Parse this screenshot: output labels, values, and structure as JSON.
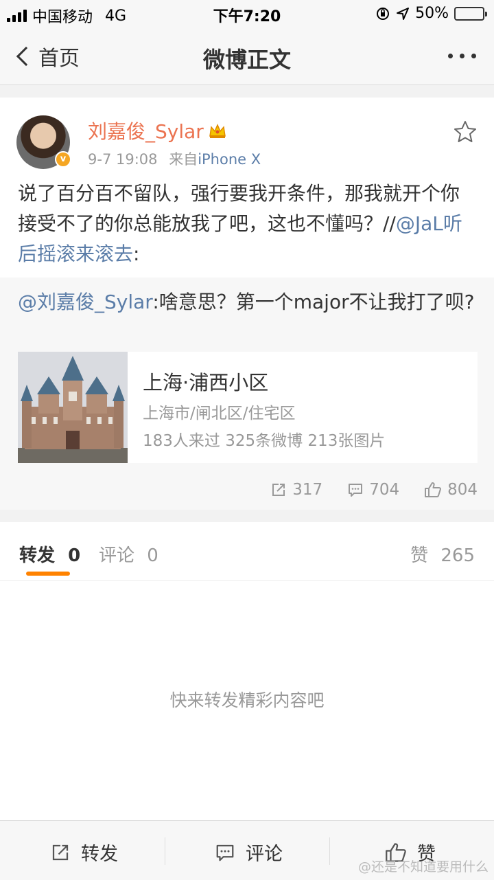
{
  "status_bar": {
    "carrier": "中国移动",
    "network": "4G",
    "time": "下午7:20",
    "battery": "50%",
    "battery_level": 0.5,
    "battery_color": "#f5c400"
  },
  "nav": {
    "back_label": "首页",
    "title": "微博正文"
  },
  "post": {
    "author": "刘嘉俊_Sylar",
    "verified_badge": "v",
    "time": "9-7 19:08",
    "source_prefix": "来自",
    "source": "iPhone X",
    "text": "说了百分百不留队，强行要我开条件，那我就开个你接受不了的你总能放我了吧，这也不懂吗？//",
    "mention": "@JaL听后摇滚来滚去",
    "mention_suffix": ":",
    "repost": {
      "mention": "@刘嘉俊_Sylar",
      "text": ":啥意思？第一个major不让我打了呗?",
      "location": {
        "name": "上海·浦西小区",
        "address": "上海市/闸北区/住宅区",
        "stats": "183人来过 325条微博 213张图片"
      }
    },
    "actions": {
      "forward_count": "317",
      "comment_count": "704",
      "like_count": "804"
    }
  },
  "tabs": {
    "forward_label": "转发",
    "forward_count": "0",
    "comment_label": "评论",
    "comment_count": "0",
    "like_label": "赞",
    "like_count": "265"
  },
  "empty_state": "快来转发精彩内容吧",
  "bottom_bar": {
    "forward": "转发",
    "comment": "评论",
    "like": "赞",
    "watermark": "@还是不知道要用什么"
  },
  "colors": {
    "accent": "#ff8200",
    "author": "#eb7350",
    "link": "#5b7da8"
  }
}
